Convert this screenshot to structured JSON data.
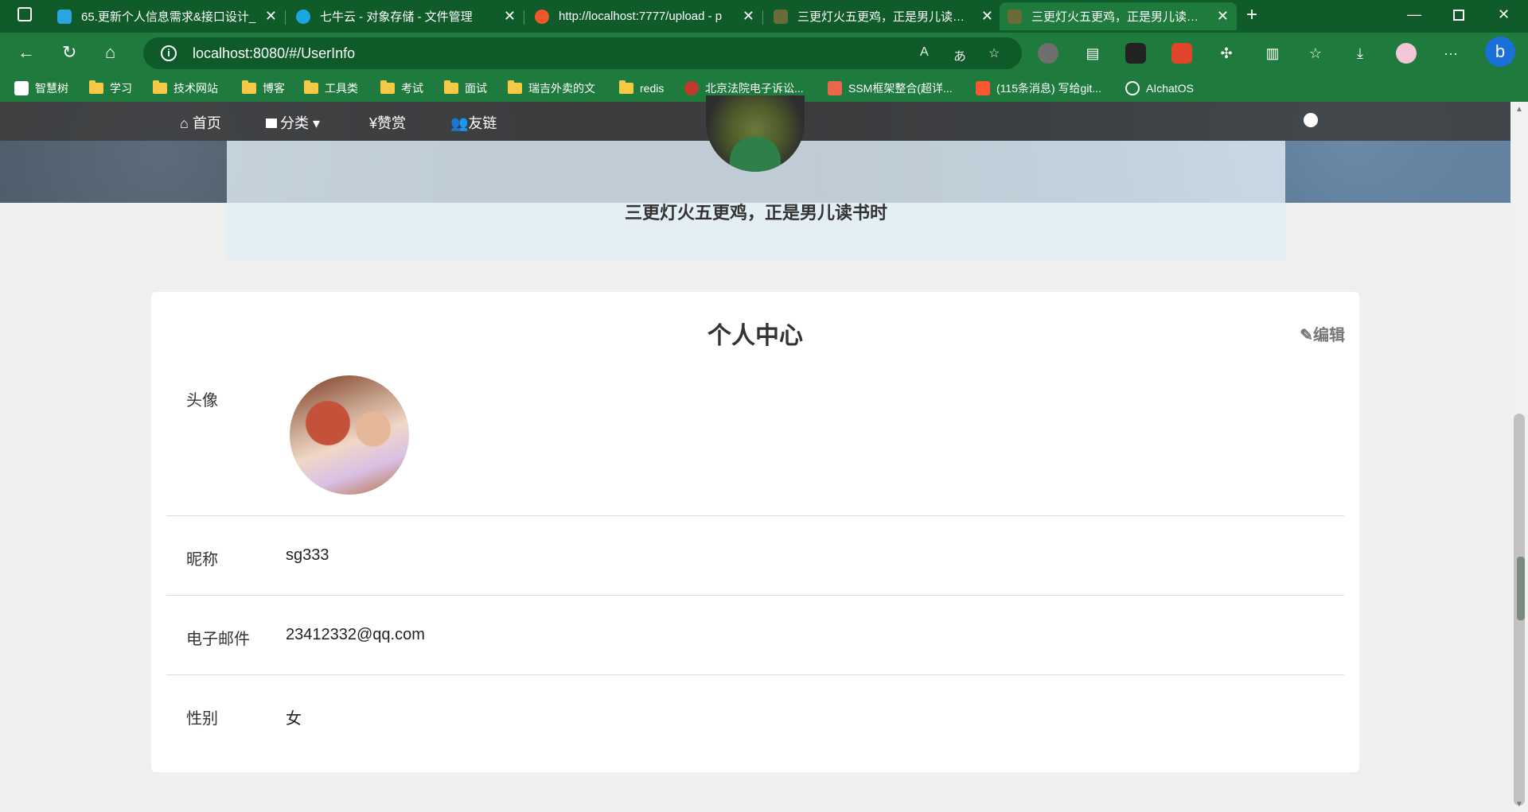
{
  "browser": {
    "tabs": [
      {
        "title": "65.更新个人信息需求&接口设计_",
        "color": "#2aa5de",
        "active": false
      },
      {
        "title": "七牛云 - 对象存储 - 文件管理",
        "color": "#1aa6e0",
        "active": false
      },
      {
        "title": "http://localhost:7777/upload - p",
        "color": "#f0582c",
        "active": false
      },
      {
        "title": "三更灯火五更鸡，正是男儿读书时",
        "color": "#6b6b3a",
        "active": false
      },
      {
        "title": "三更灯火五更鸡，正是男儿读书时",
        "color": "#6b6b3a",
        "active": true
      }
    ],
    "url": "localhost:8080/#/UserInfo",
    "bookmarks": [
      {
        "label": "智慧树",
        "icon": "app-icon"
      },
      {
        "label": "学习",
        "icon": "folder-icon"
      },
      {
        "label": "技术网站",
        "icon": "folder-icon"
      },
      {
        "label": "博客",
        "icon": "folder-icon"
      },
      {
        "label": "工具类",
        "icon": "folder-icon"
      },
      {
        "label": "考试",
        "icon": "folder-icon"
      },
      {
        "label": "面试",
        "icon": "folder-icon"
      },
      {
        "label": "瑞吉外卖的文",
        "icon": "folder-icon"
      },
      {
        "label": "redis",
        "icon": "folder-icon"
      },
      {
        "label": "北京法院电子诉讼...",
        "icon": "court-icon"
      },
      {
        "label": "SSM框架整合(超详...",
        "icon": "jianshu-icon"
      },
      {
        "label": "(115条消息) 写给git...",
        "icon": "csdn-icon"
      },
      {
        "label": "AIchatOS",
        "icon": "openai-icon"
      }
    ],
    "colors": {
      "tabbar": "#0f5b2a",
      "toolbar": "#1f7a3e"
    }
  },
  "nav": {
    "home": "首页",
    "category": "分类",
    "reward": "赞赏",
    "friends": "友链"
  },
  "site": {
    "title": "三更灯火五更鸡，正是男儿读书时"
  },
  "profile": {
    "heading": "个人中心",
    "edit": "编辑",
    "fields": {
      "avatar_label": "头像",
      "nickname_label": "昵称",
      "nickname": "sg333",
      "email_label": "电子邮件",
      "email": "23412332@qq.com",
      "gender_label": "性别",
      "gender": "女"
    }
  }
}
